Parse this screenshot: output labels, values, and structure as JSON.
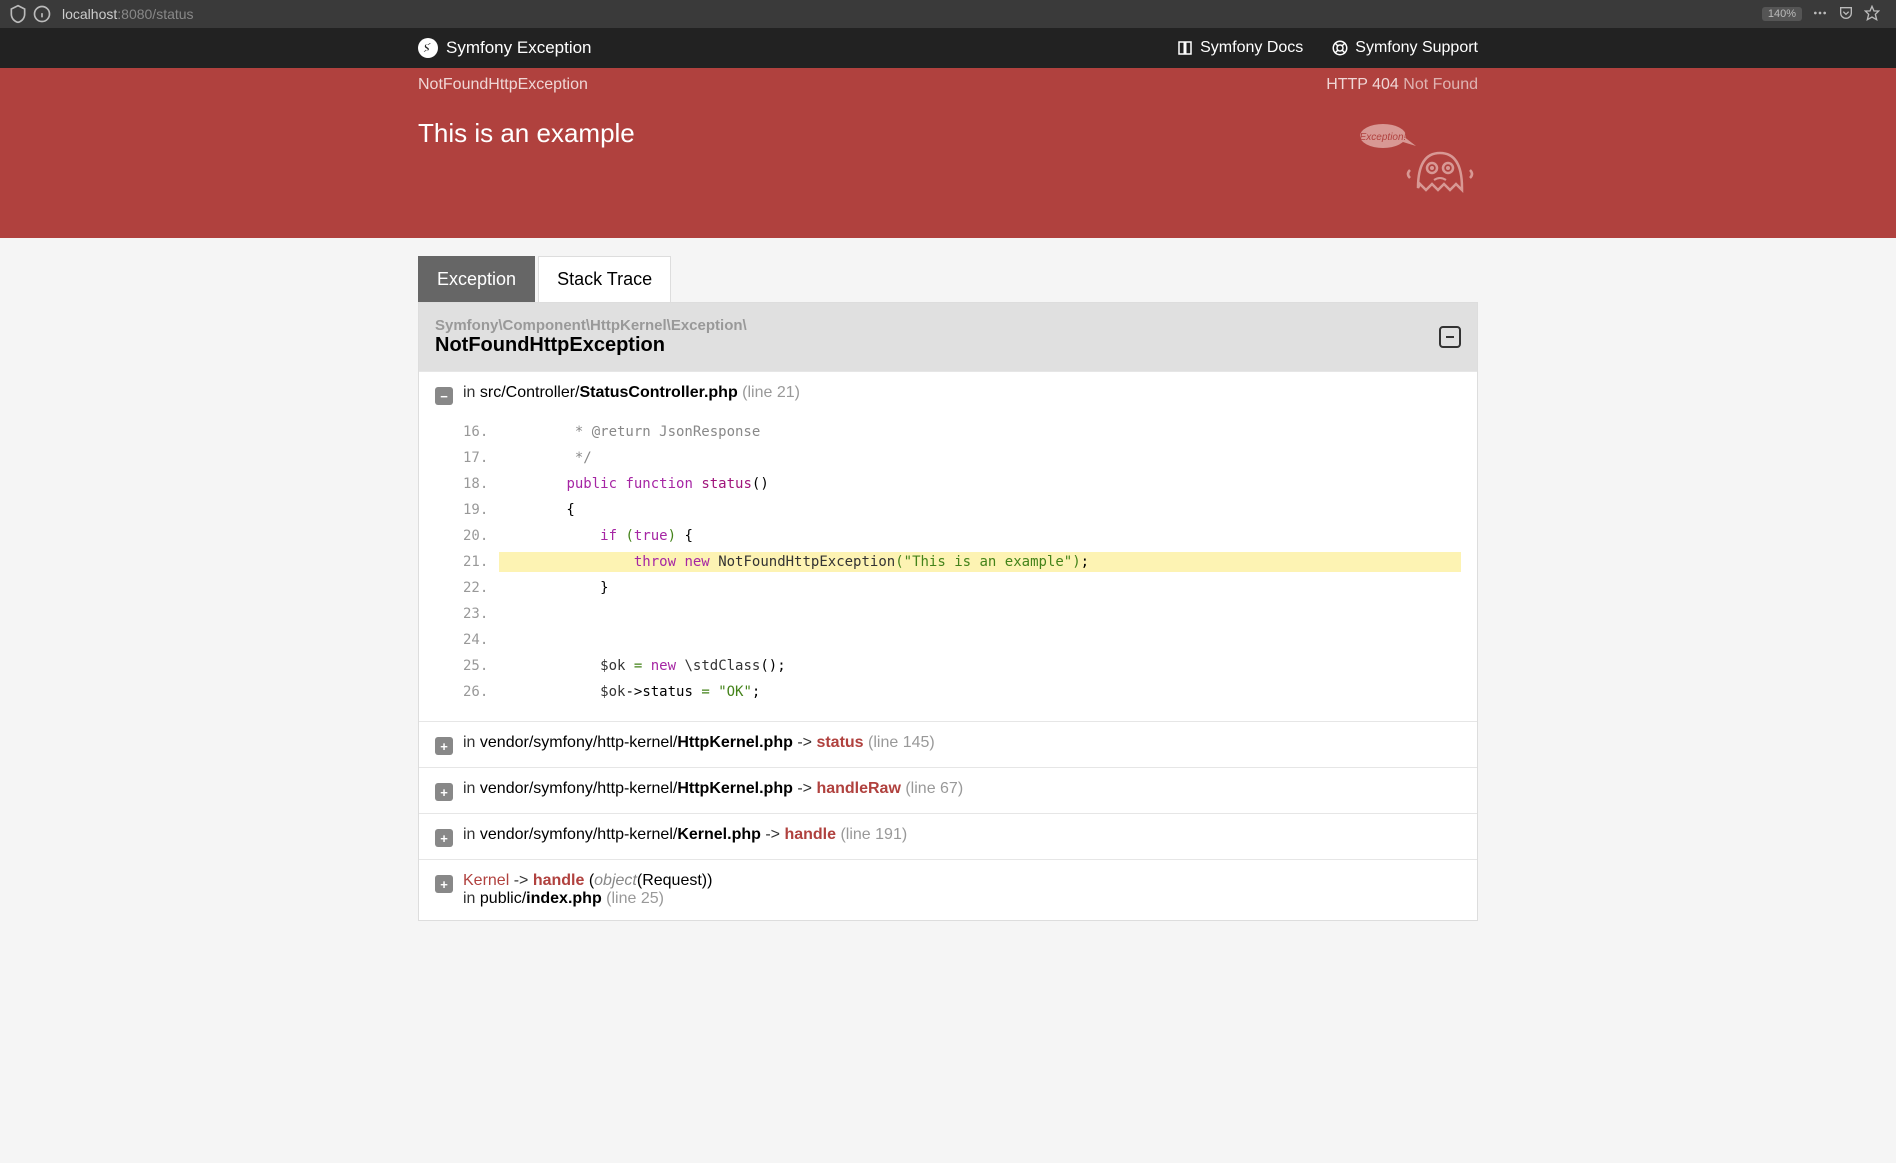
{
  "browser": {
    "url_host": "localhost",
    "url_port_path": ":8080/status",
    "zoom": "140%"
  },
  "top_header": {
    "title": "Symfony Exception",
    "docs": "Symfony Docs",
    "support": "Symfony Support"
  },
  "error": {
    "exception_class": "NotFoundHttpException",
    "http_label": "HTTP 404",
    "http_text": "Not Found",
    "message": "This is an example"
  },
  "tabs": {
    "exception": "Exception",
    "stack_trace": "Stack Trace"
  },
  "trace_head": {
    "namespace": "Symfony\\Component\\HttpKernel\\Exception\\",
    "class": "NotFoundHttpException"
  },
  "frame0": {
    "in": "in ",
    "path": "src/Controller/",
    "file": "StatusController.php",
    "line": " (line 21)"
  },
  "code": {
    "l16": {
      "n": "16.",
      "text": "         * @return JsonResponse"
    },
    "l17": {
      "n": "17.",
      "text": "         */"
    },
    "l18": {
      "n": "18.",
      "pre": "        ",
      "kw1": "public",
      "sp": " ",
      "kw2": "function",
      "sp2": " ",
      "fn": "status",
      "rest": "()"
    },
    "l19": {
      "n": "19.",
      "text": "        {"
    },
    "l20": {
      "n": "20.",
      "pre": "            ",
      "kw": "if",
      "sp": " ",
      "p1": "(",
      "kw2": "true",
      "p2": ")",
      "rest": " {"
    },
    "l21": {
      "n": "21.",
      "pre": "                ",
      "kw1": "throw",
      "sp": " ",
      "kw2": "new",
      "sp2": " ",
      "cls": "NotFoundHttpException",
      "p1": "(",
      "str": "\"This is an example\"",
      "p2": ")",
      "semi": ";"
    },
    "l22": {
      "n": "22.",
      "text": "            }"
    },
    "l23": {
      "n": "23.",
      "text": ""
    },
    "l24": {
      "n": "24.",
      "text": ""
    },
    "l25": {
      "n": "25.",
      "pre": "            ",
      "var": "$ok ",
      "op": "=",
      "sp": " ",
      "kw": "new",
      "sp2": " ",
      "cls": "\\stdClass",
      "rest": "();"
    },
    "l26": {
      "n": "26.",
      "pre": "            ",
      "var": "$ok",
      "arrow": "->",
      "prop": "status ",
      "op": "=",
      "sp": " ",
      "str": "\"OK\"",
      "semi": ";"
    }
  },
  "frames": [
    {
      "in": "in ",
      "path": "vendor/symfony/http-kernel/",
      "file": "HttpKernel.php",
      "arrow": "  ->  ",
      "method": "status",
      "line": " (line 145)"
    },
    {
      "in": "in ",
      "path": "vendor/symfony/http-kernel/",
      "file": "HttpKernel.php",
      "arrow": "  ->  ",
      "method": "handleRaw",
      "line": " (line 67)"
    },
    {
      "in": "in ",
      "path": "vendor/symfony/http-kernel/",
      "file": "Kernel.php",
      "arrow": "  ->  ",
      "method": "handle",
      "line": " (line 191)"
    }
  ],
  "frame_last": {
    "class": "Kernel",
    "arrow": " -> ",
    "method": "handle",
    "args_open": " (",
    "obj": "object",
    "args_rest": "(Request))",
    "in": "in ",
    "path": "public/",
    "file": "index.php",
    "line": " (line 25)"
  }
}
